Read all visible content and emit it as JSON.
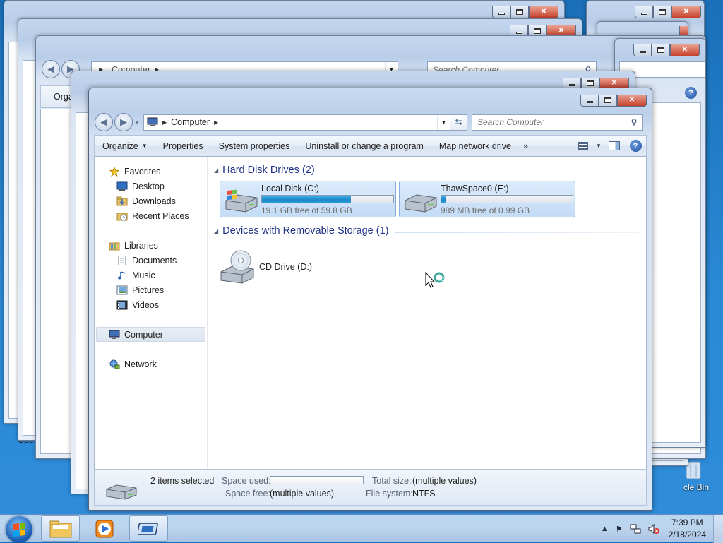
{
  "main_window": {
    "address": {
      "crumb": "Computer"
    },
    "search": {
      "placeholder": "Search Computer"
    },
    "toolbar": {
      "organize": "Organize",
      "properties": "Properties",
      "system_properties": "System properties",
      "uninstall": "Uninstall or change a program",
      "map_drive": "Map network drive",
      "overflow": "»",
      "help": "?"
    },
    "nav": {
      "favorites": "Favorites",
      "desktop": "Desktop",
      "downloads": "Downloads",
      "recent": "Recent Places",
      "libraries": "Libraries",
      "documents": "Documents",
      "music": "Music",
      "pictures": "Pictures",
      "videos": "Videos",
      "computer": "Computer",
      "network": "Network"
    },
    "groups": {
      "hdd": "Hard Disk Drives (2)",
      "removable": "Devices with Removable Storage (1)"
    },
    "drives": [
      {
        "name": "Local Disk (C:)",
        "free": "19.1 GB free of 59.8 GB",
        "used_fraction": 0.68
      },
      {
        "name": "ThawSpace0 (E:)",
        "free": "989 MB free of 0.99 GB",
        "used_fraction": 0.03
      }
    ],
    "cd": {
      "name": "CD Drive (D:)"
    },
    "details": {
      "selected": "2 items selected",
      "space_used_label": "Space used:",
      "space_free_label": "Space free:",
      "space_free_value": "(multiple values)",
      "total_size_label": "Total size:",
      "total_size_value": "(multiple values)",
      "fs_label": "File system:",
      "fs_value": "NTFS"
    }
  },
  "background_windows": {
    "address_crumb": "Computer",
    "search_placeholder": "Search Computer",
    "organize_fragment": "Orga",
    "desktop_label_fragment": "cle Bin",
    "spe_fragment": "Spe"
  },
  "taskbar": {
    "time": "7:39 PM",
    "date": "2/18/2024"
  },
  "colors": {
    "group_header": "#1e3287",
    "bar_fill": "#1e86c7",
    "close_button": "#c7412c"
  }
}
